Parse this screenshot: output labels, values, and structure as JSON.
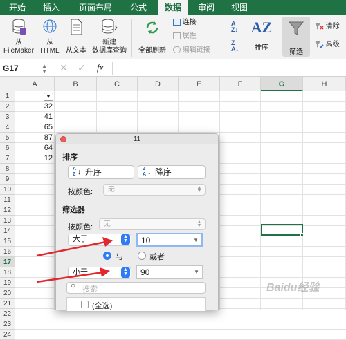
{
  "tabs": [
    "开始",
    "插入",
    "页面布局",
    "公式",
    "数据",
    "审阅",
    "视图"
  ],
  "active_tab": "数据",
  "ribbon": {
    "from_filemaker": [
      "从",
      "FileMaker"
    ],
    "from_html": [
      "从",
      "HTML"
    ],
    "from_text": "从文本",
    "new_db_query": [
      "新建",
      "数据库查询"
    ],
    "refresh_all": "全部刷新",
    "connections": "连接",
    "properties": "属性",
    "edit_links": "编辑链接",
    "sort": "排序",
    "filter": "筛选",
    "clear": "清除",
    "advanced": "高级"
  },
  "formula_bar": {
    "name_box": "G17",
    "fx": "fx"
  },
  "columns": [
    "A",
    "B",
    "C",
    "D",
    "E",
    "F",
    "G",
    "H"
  ],
  "selected_column": "G",
  "rows": [
    "1",
    "2",
    "3",
    "4",
    "5",
    "6",
    "7",
    "8",
    "9",
    "10",
    "11",
    "12",
    "13",
    "14",
    "15",
    "16",
    "17",
    "18",
    "19",
    "20",
    "21",
    "22",
    "23",
    "24"
  ],
  "selected_row": "17",
  "cells_a": [
    "32",
    "41",
    "65",
    "87",
    "64",
    "12"
  ],
  "dialog": {
    "title": "11",
    "sort_section": "排序",
    "ascending": "升序",
    "descending": "降序",
    "by_color_label": "按颜色:",
    "by_color_value": "无",
    "filter_section": "筛选器",
    "filter_color_label": "按颜色:",
    "filter_color_value": "无",
    "cond1_op": "大于",
    "cond1_value": "10",
    "and_label": "与",
    "or_label": "或者",
    "cond2_op": "小于",
    "cond2_value": "90",
    "search_placeholder": "搜索",
    "select_all": "(全选)"
  },
  "watermark": "Baidu经验",
  "colors": {
    "excel_green": "#1f7244",
    "accent_blue": "#2f7df6",
    "arrow_red": "#e0282e"
  }
}
